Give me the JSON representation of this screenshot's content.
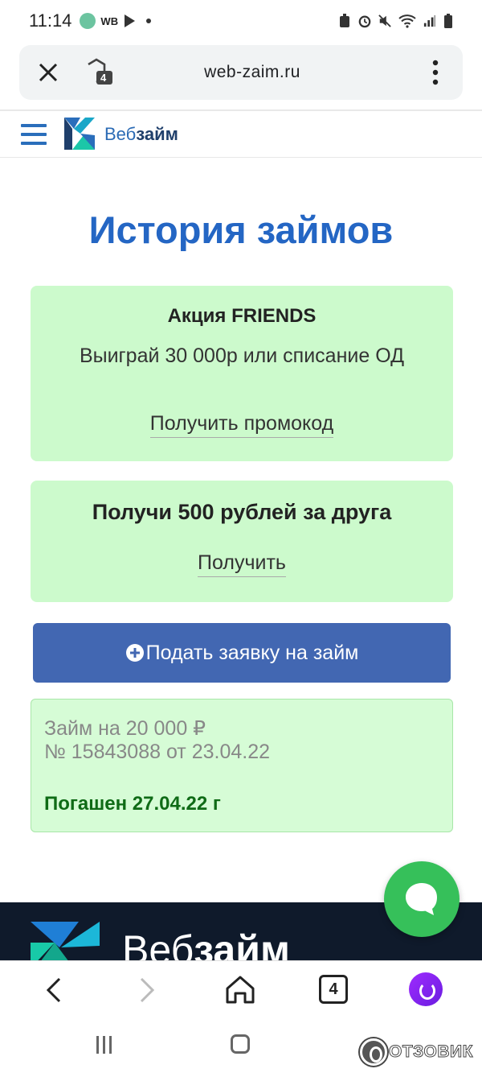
{
  "status_bar": {
    "time": "11:14",
    "wb_label": "WB"
  },
  "browser": {
    "url": "web-zaim.ru",
    "tab_count": "4",
    "shield_count": "4"
  },
  "site": {
    "logo_prefix": "Веб",
    "logo_suffix": "займ"
  },
  "page": {
    "title": "История займов"
  },
  "promo_friends": {
    "title": "Акция FRIENDS",
    "description": "Выиграй 30 000р или списание ОД",
    "link_label": "Получить промокод"
  },
  "promo_referral": {
    "title": "Получи 500 рублей за друга",
    "link_label": "Получить"
  },
  "cta": {
    "label": "Подать заявку на займ"
  },
  "loan": {
    "amount_text": "Займ на 20 000 ₽",
    "number_text": "№ 15843088 от 23.04.22",
    "status_text": "Погашен 27.04.22 г"
  },
  "footer": {
    "logo_prefix": "Веб",
    "logo_suffix": "займ"
  },
  "watermark": {
    "text": "ОТЗОВИК"
  },
  "colors": {
    "title_blue": "#2466c4",
    "card_green": "#ccfacc",
    "cta_blue": "#4267b2",
    "status_green": "#0f6b16",
    "chat_green": "#36c05a",
    "footer_dark": "#0f1a2b"
  }
}
